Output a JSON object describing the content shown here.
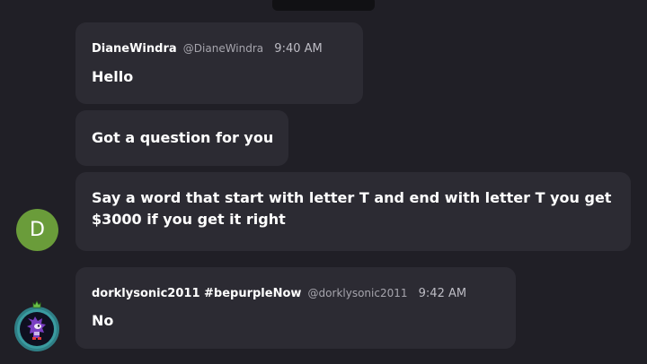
{
  "messages": [
    {
      "author": "DianeWindra",
      "handle": "@DianeWindra",
      "time": "9:40 AM",
      "text": "Hello"
    },
    {
      "text": "Got a question for you"
    },
    {
      "text": "Say a word that start with letter T and end with letter T you get $3000 if you get it right"
    },
    {
      "author": "dorklysonic2011 #bepurpleNow",
      "handle": "@dorklysonic2011",
      "time": "9:42 AM",
      "text": "No"
    }
  ],
  "avatars": {
    "diane_initial": "D",
    "diane_color": "#6a9c3a",
    "dorkly_icon": "purple-hedgehog-avatar-icon",
    "dorkly_badge_icon": "green-crown-badge-icon"
  },
  "colors": {
    "background": "#201f26",
    "bubble": "#2c2b33",
    "handle": "#a6a5ad"
  }
}
